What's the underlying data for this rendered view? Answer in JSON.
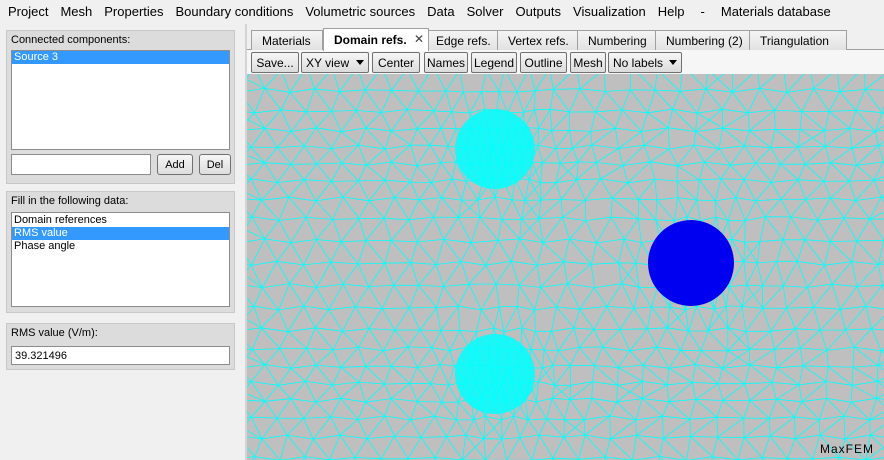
{
  "menu": [
    "Project",
    "Mesh",
    "Properties",
    "Boundary conditions",
    "Volumetric sources",
    "Data",
    "Solver",
    "Outputs",
    "Visualization",
    "Help",
    "-",
    "Materials database"
  ],
  "connected": {
    "title": "Connected components:",
    "items": [
      "Source 3"
    ],
    "new_value": "",
    "add_label": "Add",
    "del_label": "Del"
  },
  "fill": {
    "title": "Fill in the following data:",
    "items": [
      "Domain references",
      "RMS value",
      "Phase angle"
    ],
    "selected": "RMS value"
  },
  "rms": {
    "title": "RMS value (V/m):",
    "value": "39.321496"
  },
  "tabs": [
    {
      "label": "Materials",
      "active": false
    },
    {
      "label": "Domain refs.",
      "active": true,
      "close": "✕"
    },
    {
      "label": "Edge refs.",
      "active": false
    },
    {
      "label": "Vertex refs.",
      "active": false
    },
    {
      "label": "Numbering",
      "active": false
    },
    {
      "label": "Numbering (2)",
      "active": false
    },
    {
      "label": "Triangulation",
      "active": false
    }
  ],
  "toolbar": {
    "save": "Save...",
    "view": "XY view",
    "center": "Center",
    "names": "Names",
    "legend": "Legend",
    "outline": "Outline",
    "mesh": "Mesh",
    "labels": "No labels"
  },
  "viewer": {
    "brand": "MaxFEM",
    "colors": {
      "background": "#bfbfbf",
      "mesh": "#00ffff",
      "domain": "#0000f0"
    }
  }
}
